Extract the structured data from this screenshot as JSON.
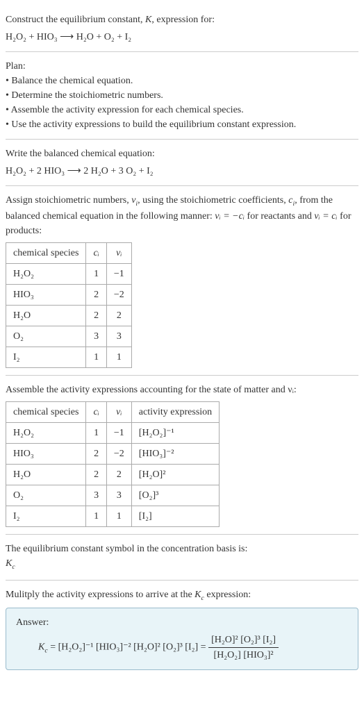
{
  "sec1": {
    "line1": "Construct the equilibrium constant, ",
    "K": "K",
    "line1b": ", expression for:",
    "eq": "H₂O₂ + HIO₃  ⟶  H₂O + O₂ + I₂"
  },
  "sec2": {
    "heading": "Plan:",
    "items": [
      "• Balance the chemical equation.",
      "• Determine the stoichiometric numbers.",
      "• Assemble the activity expression for each chemical species.",
      "• Use the activity expressions to build the equilibrium constant expression."
    ]
  },
  "sec3": {
    "heading": "Write the balanced chemical equation:",
    "eq": "H₂O₂ + 2 HIO₃  ⟶  2 H₂O + 3 O₂ + I₂"
  },
  "sec4": {
    "p1a": "Assign stoichiometric numbers, ",
    "nu": "ν",
    "sub_i": "i",
    "p1b": ", using the stoichiometric coefficients, ",
    "c": "c",
    "p1c": ", from the balanced chemical equation in the following manner: ",
    "rel1": "νᵢ = −cᵢ",
    "p1d": " for reactants and ",
    "rel2": "νᵢ = cᵢ",
    "p1e": " for products:",
    "headers": {
      "species": "chemical species",
      "ci": "cᵢ",
      "nui": "νᵢ"
    },
    "rows": [
      {
        "sp": "H₂O₂",
        "ci": "1",
        "nui": "−1"
      },
      {
        "sp": "HIO₃",
        "ci": "2",
        "nui": "−2"
      },
      {
        "sp": "H₂O",
        "ci": "2",
        "nui": "2"
      },
      {
        "sp": "O₂",
        "ci": "3",
        "nui": "3"
      },
      {
        "sp": "I₂",
        "ci": "1",
        "nui": "1"
      }
    ]
  },
  "sec5": {
    "heading": "Assemble the activity expressions accounting for the state of matter and νᵢ:",
    "headers": {
      "species": "chemical species",
      "ci": "cᵢ",
      "nui": "νᵢ",
      "act": "activity expression"
    },
    "rows": [
      {
        "sp": "H₂O₂",
        "ci": "1",
        "nui": "−1",
        "act": "[H₂O₂]⁻¹"
      },
      {
        "sp": "HIO₃",
        "ci": "2",
        "nui": "−2",
        "act": "[HIO₃]⁻²"
      },
      {
        "sp": "H₂O",
        "ci": "2",
        "nui": "2",
        "act": "[H₂O]²"
      },
      {
        "sp": "O₂",
        "ci": "3",
        "nui": "3",
        "act": "[O₂]³"
      },
      {
        "sp": "I₂",
        "ci": "1",
        "nui": "1",
        "act": "[I₂]"
      }
    ]
  },
  "sec6": {
    "heading": "The equilibrium constant symbol in the concentration basis is:",
    "symbol": "K",
    "sub_c": "c"
  },
  "sec7": {
    "heading": "Mulitply the activity expressions to arrive at the ",
    "Kc": "K",
    "sub_c": "c",
    "headingb": " expression:",
    "answer_label": "Answer:",
    "Kc_lhs": "K",
    "eq_part": " = [H₂O₂]⁻¹ [HIO₃]⁻² [H₂O]² [O₂]³ [I₂] = ",
    "frac_num": "[H₂O]² [O₂]³ [I₂]",
    "frac_den": "[H₂O₂] [HIO₃]²"
  }
}
